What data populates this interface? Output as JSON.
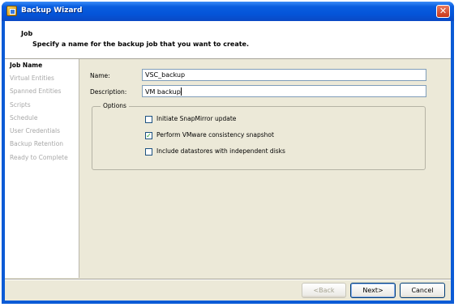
{
  "window": {
    "title": "Backup Wizard",
    "close_glyph": "✕",
    "app_icon": "backup-wizard-icon"
  },
  "header": {
    "title": "Job",
    "subtitle": "Specify a name for the backup job that you want to create."
  },
  "steps": [
    {
      "label": "Job Name",
      "active": true
    },
    {
      "label": "Virtual Entities",
      "active": false
    },
    {
      "label": "Spanned Entities",
      "active": false
    },
    {
      "label": "Scripts",
      "active": false
    },
    {
      "label": "Schedule",
      "active": false
    },
    {
      "label": "User Credentials",
      "active": false
    },
    {
      "label": "Backup Retention",
      "active": false
    },
    {
      "label": "Ready to Complete",
      "active": false
    }
  ],
  "form": {
    "name_label": "Name:",
    "name_value": "VSC_backup",
    "description_label": "Description:",
    "description_value": "VM backup"
  },
  "options": {
    "title": "Options",
    "items": [
      {
        "label": "Initiate SnapMirror update",
        "checked": false
      },
      {
        "label": "Perform VMware consistency snapshot",
        "checked": true
      },
      {
        "label": "Include datastores with independent disks",
        "checked": false
      }
    ]
  },
  "buttons": {
    "back": "<Back",
    "next": "Next>",
    "cancel": "Cancel"
  },
  "colors": {
    "titlebar": "#0454d8",
    "close": "#c8381a",
    "dialog": "#ece9d8"
  }
}
